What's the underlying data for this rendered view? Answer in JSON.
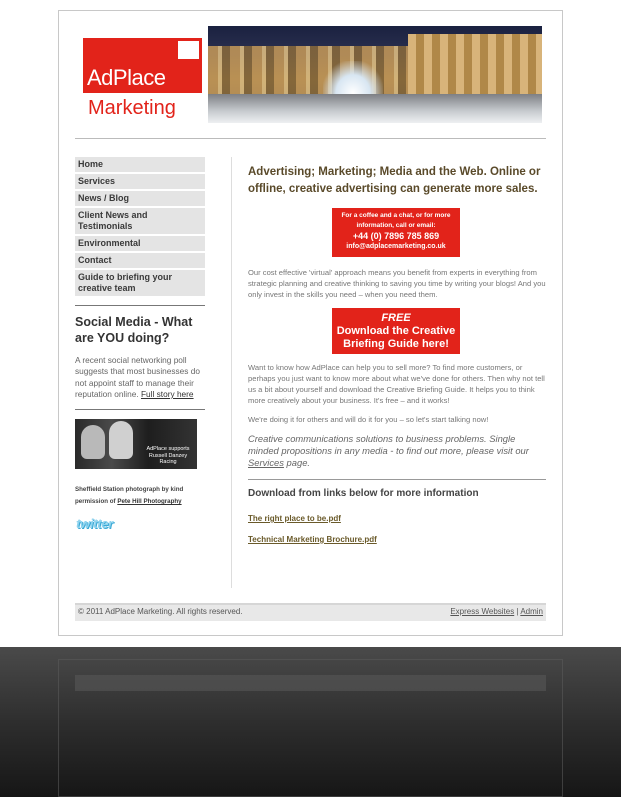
{
  "logo": {
    "line1": "AdPlace",
    "line2": "Marketing"
  },
  "nav": {
    "items": [
      "Home",
      "Services",
      "News / Blog",
      "Client News and Testimonials",
      "Environmental",
      "Contact",
      "Guide to briefing your creative team"
    ]
  },
  "sidebar": {
    "social_title": "Social Media - What are YOU doing?",
    "social_text": "A recent social networking poll suggests that most businesses do not appoint staff to manage their reputation online.",
    "social_link": "Full story here",
    "photo_caption_overlay": "AdPlace supports Russell Danzey Racing",
    "photo_caption_text": "Sheffield Station photograph by kind permission of",
    "photo_caption_link": "Pete Hill Photography",
    "twitter_label": "twitter"
  },
  "main": {
    "headline": "Advertising; Marketing; Media and the Web. Online or offline, creative advertising can generate more sales.",
    "contact_box": {
      "line1": "For a coffee and a chat, or for more information, call or email:",
      "phone": "+44 (0) 7896 785 869",
      "email": "info@adplacemarketing.co.uk"
    },
    "para1": "Our cost effective 'virtual' approach means you benefit from experts in everything from strategic planning and creative thinking to saving you time by writing your blogs! And you only invest in the skills you need – when you need them.",
    "free_box": {
      "line1": "FREE",
      "line2": "Download the Creative Briefing Guide here!"
    },
    "para2": "Want to know how AdPlace can help you to sell more? To find more customers, or perhaps you just want to know more about what we've done for others. Then why not tell us a bit about yourself and download the Creative Briefing Guide. It helps you to think more creatively about your business. It's free – and it works!",
    "para3": "We're doing it for others and will do it for you – so let's start talking now!",
    "tagline_before": "Creative communications solutions to business problems. Single minded propositions in any media - to find out more, please visit our",
    "tagline_link": "Services",
    "tagline_after": " page.",
    "download_title": "Download from links below for more information",
    "downloads": [
      "The right place to be.pdf",
      "Technical Marketing Brochure.pdf"
    ]
  },
  "footer": {
    "copyright": "© 2011 AdPlace Marketing. All rights reserved.",
    "link1": "Express Websites",
    "separator": "|",
    "link2": "Admin"
  },
  "colors": {
    "brand_red": "#e2231a",
    "nav_bg": "#e4e4e4",
    "twitter_blue": "#8fd3ee"
  }
}
